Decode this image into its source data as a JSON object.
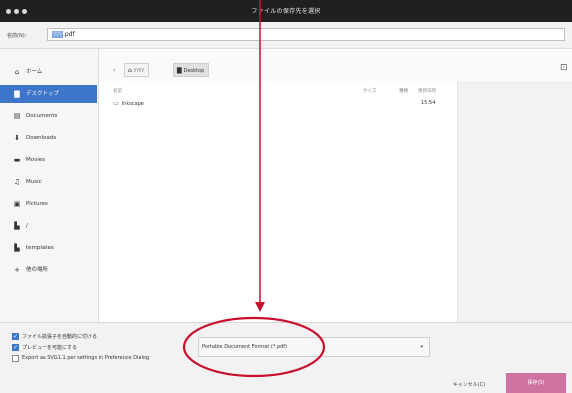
{
  "window": {
    "title": "ファイルの保存先を選択"
  },
  "name_bar": {
    "label": "名前(N):",
    "value_selected": "ｿｿｿ",
    "value_rest": ".pdf"
  },
  "sidebar": {
    "items": [
      {
        "icon": "home-icon",
        "glyph": "⌂",
        "label": "ホーム"
      },
      {
        "icon": "desktop-icon",
        "glyph": "▇",
        "label": "デスクトップ",
        "active": true
      },
      {
        "icon": "documents-icon",
        "glyph": "▤",
        "label": "Documents"
      },
      {
        "icon": "downloads-icon",
        "glyph": "⬇",
        "label": "Downloads"
      },
      {
        "icon": "movies-icon",
        "glyph": "▬",
        "label": "Movies"
      },
      {
        "icon": "music-icon",
        "glyph": "♫",
        "label": "Music"
      },
      {
        "icon": "pictures-icon",
        "glyph": "▣",
        "label": "Pictures"
      },
      {
        "icon": "drive-icon",
        "glyph": "▙",
        "label": "/"
      },
      {
        "icon": "folder-icon",
        "glyph": "▙",
        "label": "templates"
      },
      {
        "icon": "plus-icon",
        "glyph": "+",
        "label": "他の場所"
      }
    ]
  },
  "path_bar": {
    "back_glyph": "‹",
    "crumbs": [
      {
        "icon": "home-icon",
        "glyph": "⌂",
        "label": "ｿｿｿｿ"
      },
      {
        "icon": "desktop-icon",
        "glyph": "▇",
        "label": "Desktop",
        "active": true
      }
    ],
    "new_folder_glyph": "⊡"
  },
  "file_list": {
    "headers": {
      "name": "名前",
      "size": "サイズ",
      "kind": "種類",
      "modified": "更新日時"
    },
    "rows": [
      {
        "icon": "folder-icon",
        "name": "Inkscape",
        "modified": "15:54"
      }
    ]
  },
  "options": {
    "auto_extension": {
      "label": "ファイル拡張子を自動的に付ける",
      "checked": true
    },
    "preview": {
      "label": "プレビューを可能にする",
      "checked": true
    },
    "export_svg": {
      "label": "Export as SVG1.1 per settings in Preference Dialog",
      "checked": false
    }
  },
  "format": {
    "selected": "Portable Document Format (*.pdf)"
  },
  "buttons": {
    "cancel": "キャンセル(C)",
    "save": "保存(S)"
  }
}
